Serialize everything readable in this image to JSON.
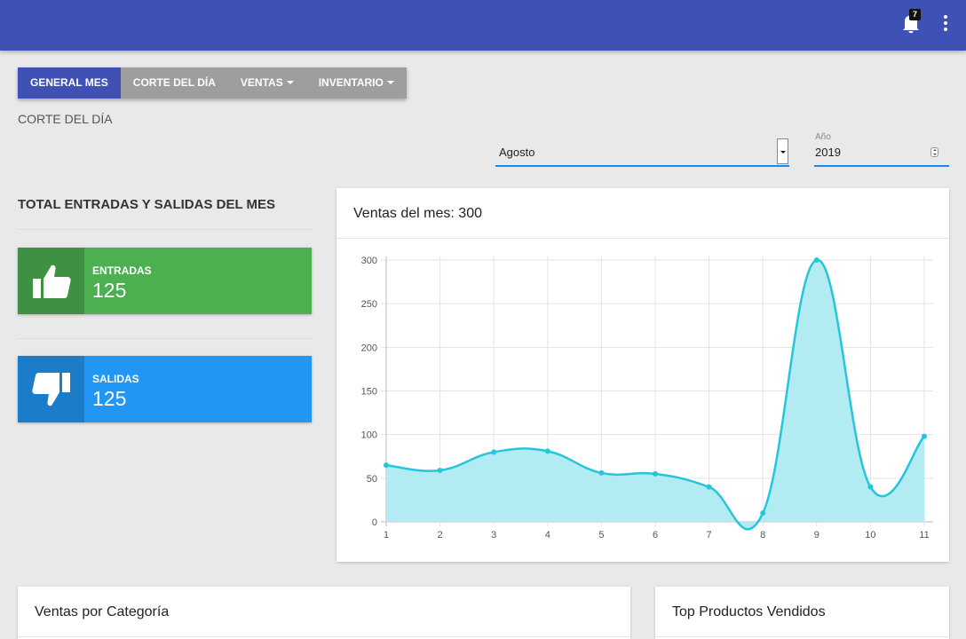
{
  "topbar": {
    "color": "#3f51b5",
    "notifications_count": "7",
    "bell_icon": "bell-icon",
    "menu_icon": "more-vert-icon"
  },
  "nav": {
    "tabs": [
      {
        "label": "GENERAL MES",
        "active": true
      },
      {
        "label": "CORTE DEL DÍA",
        "active": false
      },
      {
        "label": "VENTAS",
        "active": false,
        "dropdown": true
      },
      {
        "label": "INVENTARIO",
        "active": false,
        "dropdown": true
      }
    ]
  },
  "section_label": "CORTE DEL DÍA",
  "filters": {
    "month_value": "Agosto",
    "year_label": "Año",
    "year_value": "2019"
  },
  "totals": {
    "title": "TOTAL ENTRADAS Y SALIDAS DEL MES",
    "entradas": {
      "label": "ENTRADAS",
      "value": "125",
      "icon": "thumbs-up-icon",
      "color": "#4caf50"
    },
    "salidas": {
      "label": "SALIDAS",
      "value": "125",
      "icon": "thumbs-down-icon",
      "color": "#2196f3"
    }
  },
  "chart_card": {
    "title": "Ventas del mes: 300"
  },
  "bottom_cards": {
    "left_title": "Ventas por Categoría",
    "right_title": "Top Productos Vendidos"
  },
  "chart_data": {
    "type": "area",
    "x": [
      1,
      2,
      3,
      4,
      5,
      6,
      7,
      8,
      9,
      10,
      11
    ],
    "series": [
      {
        "values": [
          65,
          59,
          80,
          81,
          56,
          55,
          40,
          10,
          300,
          40,
          98
        ],
        "color": "#26c6da",
        "fill": "#b2ebf2"
      }
    ],
    "yticks": [
      0,
      50,
      100,
      150,
      200,
      250,
      300
    ],
    "ylim": [
      0,
      300
    ],
    "grid": true,
    "smooth": true
  }
}
